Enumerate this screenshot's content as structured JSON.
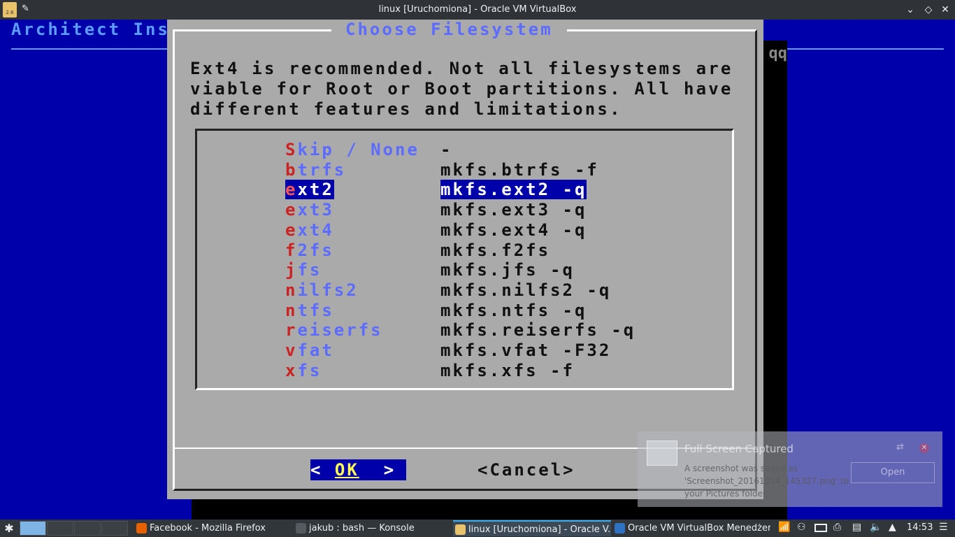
{
  "window": {
    "title": "linux [Uruchomiona] - Oracle VM VirtualBox",
    "app_icon": "virtualbox-icon",
    "pin_glyph": "✎",
    "controls": [
      "⌄",
      "◇",
      "✕"
    ]
  },
  "installer": {
    "bg_title": "Architect Ins",
    "shadow_text": "qq",
    "dialog_title": "Choose Filesystem",
    "description": "Ext4 is recommended. Not all filesystems are\nviable for Root or Boot partitions. All have\ndifferent features and limitations.",
    "options": [
      {
        "hot": "S",
        "rest": "kip / None",
        "command": "-",
        "selected": false
      },
      {
        "hot": "b",
        "rest": "trfs",
        "command": "mkfs.btrfs -f",
        "selected": false
      },
      {
        "hot": "e",
        "rest": "xt2",
        "command": "mkfs.ext2 -q",
        "selected": true
      },
      {
        "hot": "e",
        "rest": "xt3",
        "command": "mkfs.ext3 -q",
        "selected": false
      },
      {
        "hot": "e",
        "rest": "xt4",
        "command": "mkfs.ext4 -q",
        "selected": false
      },
      {
        "hot": "f",
        "rest": "2fs",
        "command": "mkfs.f2fs",
        "selected": false
      },
      {
        "hot": "j",
        "rest": "fs",
        "command": "mkfs.jfs -q",
        "selected": false
      },
      {
        "hot": "n",
        "rest": "ilfs2",
        "command": "mkfs.nilfs2 -q",
        "selected": false
      },
      {
        "hot": "n",
        "rest": "tfs",
        "command": "mkfs.ntfs -q",
        "selected": false
      },
      {
        "hot": "r",
        "rest": "eiserfs",
        "command": "mkfs.reiserfs -q",
        "selected": false
      },
      {
        "hot": "v",
        "rest": "fat",
        "command": "mkfs.vfat -F32",
        "selected": false
      },
      {
        "hot": "x",
        "rest": "fs",
        "command": "mkfs.xfs -f",
        "selected": false
      }
    ],
    "ok_left": "< ",
    "ok_label": "OK",
    "ok_right": "  >",
    "cancel_label": "<Cancel>"
  },
  "notification": {
    "title": "Full Screen Captured",
    "body": "A screenshot was saved as 'Screenshot_20161014_145327.png' to your Pictures folder.",
    "open_label": "Open",
    "close_glyph": "✕",
    "swap_glyph": "⇄"
  },
  "taskbar": {
    "launcher_glyph": "✱",
    "tasks": [
      {
        "label": "Facebook - Mozilla Firefox",
        "icon_color": "#e66000",
        "active": false
      },
      {
        "label": "jakub : bash — Konsole",
        "icon_color": "#555a60",
        "active": false
      },
      {
        "label": "linux [Uruchomiona] - Oracle V...",
        "icon_color": "#e8c36b",
        "active": true
      },
      {
        "label": "Oracle VM VirtualBox Menedżer",
        "icon_color": "#2f72c4",
        "active": false
      }
    ],
    "tray_icons": [
      "wifi-icon",
      "people-icon",
      "battery-icon",
      "printer-icon",
      "clipboard-icon",
      "volume-icon",
      "expand-tray-icon"
    ],
    "clock": "14:53",
    "menu_glyph": "☰"
  }
}
